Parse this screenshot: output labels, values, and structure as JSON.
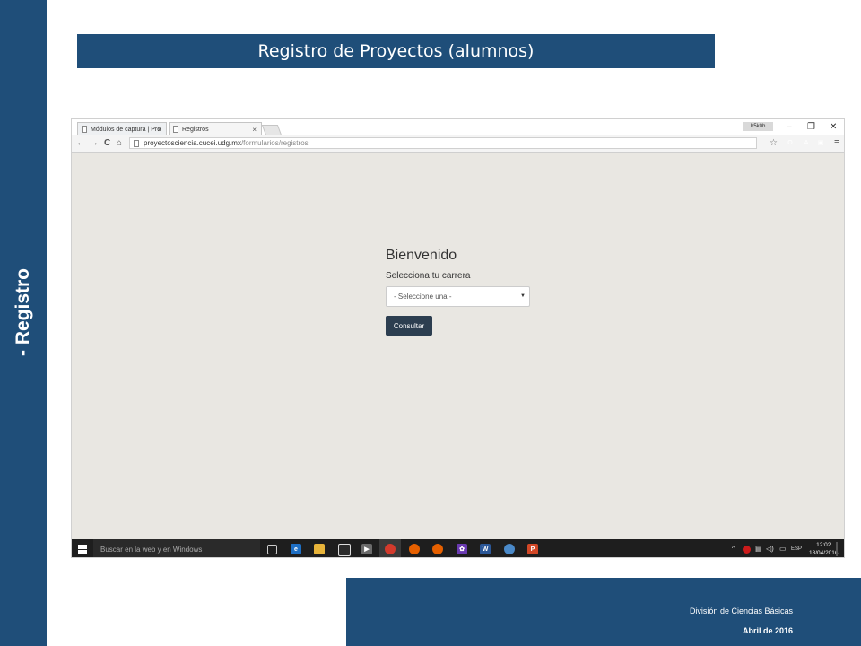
{
  "slide": {
    "side_label": "- Registro",
    "title": "Registro de Proyectos (alumnos)",
    "footer_division": "División de Ciencias Básicas",
    "footer_date": "Abril de 2016"
  },
  "browser": {
    "tabs": [
      {
        "label": "Módulos de captura | Pro",
        "active": false
      },
      {
        "label": "Registros",
        "active": true
      }
    ],
    "tab_close": "×",
    "incognito_label": "Ir5k0b",
    "window_controls": [
      "–",
      "❐",
      "✕"
    ],
    "nav": {
      "back": "←",
      "forward": "→",
      "reload": "C",
      "home": "⌂"
    },
    "url_host": "proyectosciencia.cucei.udg.mx",
    "url_path": "/formularios/registros",
    "star": "☆",
    "extensions": [
      {
        "name": "opera-icon",
        "glyph": "O",
        "color": "#cc1b1b"
      },
      {
        "name": "pdf-icon",
        "glyph": "A",
        "color": "#b30b00"
      },
      {
        "name": "extension-icon",
        "glyph": "▣",
        "color": "#444444"
      },
      {
        "name": "skype-icon",
        "glyph": "S",
        "color": "#00aff0"
      }
    ],
    "menu": "≡"
  },
  "page": {
    "heading": "Bienvenido",
    "select_label": "Selecciona tu carrera",
    "select_value": "- Seleccione una -",
    "select_caret": "▼",
    "button_label": "Consultar"
  },
  "taskbar": {
    "search_placeholder": "Buscar en la web y en Windows",
    "apps": [
      {
        "name": "task-view-icon",
        "glyph": "▭",
        "color": "#1e1e1e"
      },
      {
        "name": "edge-icon",
        "glyph": "e",
        "color": "#1e6fc4"
      },
      {
        "name": "file-explorer-icon",
        "glyph": "▬",
        "color": "#e8b43a"
      },
      {
        "name": "store-icon",
        "glyph": "▣",
        "color": "#2a2a2a"
      },
      {
        "name": "media-player-icon",
        "glyph": "▶",
        "color": "#6b6b6b"
      },
      {
        "name": "chrome-icon",
        "glyph": "◉",
        "color": "#d33a2c"
      },
      {
        "name": "firefox-icon",
        "glyph": "●",
        "color": "#e66000"
      },
      {
        "name": "firefox-dev-icon",
        "glyph": "●",
        "color": "#e66000"
      },
      {
        "name": "settings-app-icon",
        "glyph": "✿",
        "color": "#6a3ab2"
      },
      {
        "name": "word-icon",
        "glyph": "W",
        "color": "#2b5797"
      },
      {
        "name": "paint-icon",
        "glyph": "✎",
        "color": "#4a89c8"
      },
      {
        "name": "powerpoint-icon",
        "glyph": "P",
        "color": "#d24726"
      }
    ],
    "tray": {
      "chevron": "^",
      "lang": "ESP",
      "time": "12:02",
      "date": "18/04/2016"
    }
  },
  "colors": {
    "brand": "#1f4e79",
    "page_bg": "#e9e7e2",
    "button": "#2c3e50"
  }
}
